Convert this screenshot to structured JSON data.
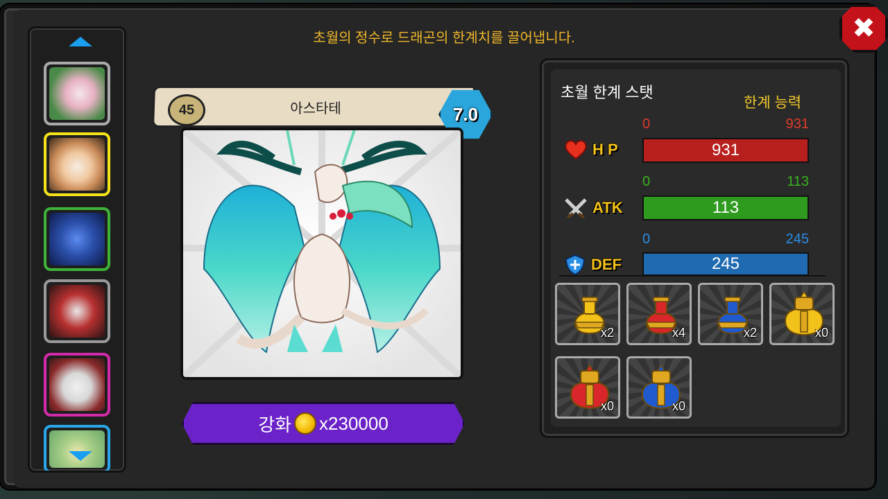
{
  "headline": "초월의 정수로 드래곤의 한계치를 끌어냅니다.",
  "close_label": "✖",
  "dragon": {
    "level": "45",
    "name": "아스타테",
    "grade": "7.0"
  },
  "upgrade": {
    "label": "강화",
    "cost": "x230000"
  },
  "stats_panel": {
    "title": "초월 한계 스탯",
    "limit_title": "한계 능력",
    "stats": [
      {
        "label": "H P",
        "min": "0",
        "max": "931",
        "value": "931",
        "fill": 1.0,
        "color": "#b8201e",
        "label_color": "#e03a2a"
      },
      {
        "label": "ATK",
        "min": "0",
        "max": "113",
        "value": "113",
        "fill": 1.0,
        "color": "#2e9a1e",
        "label_color": "#39b41e"
      },
      {
        "label": "DEF",
        "min": "0",
        "max": "245",
        "value": "245",
        "fill": 1.0,
        "color": "#1f6ab0",
        "label_color": "#2a8ee6"
      }
    ]
  },
  "items": [
    {
      "count": "x2",
      "color": "#f2c21a"
    },
    {
      "count": "x4",
      "color": "#d8262a"
    },
    {
      "count": "x2",
      "color": "#1f5acf"
    },
    {
      "count": "x0",
      "color": "#f2c21a"
    },
    {
      "count": "x0",
      "color": "#d8262a"
    },
    {
      "count": "x0",
      "color": "#1f5acf"
    }
  ],
  "sidebar_dragons": [
    {
      "border": "#3eb33a",
      "bg": "#4a8a48"
    },
    {
      "border": "#f4e21a",
      "bg": "#c98a58"
    },
    {
      "border": "#3eb33a",
      "bg": "#2a4ea8"
    },
    {
      "border": "#9a9a9a",
      "bg": "#4a2a2a"
    },
    {
      "border": "#d22aa8",
      "bg": "#8a2a2a"
    },
    {
      "border": "#2aa6e8",
      "bg": "#6aa86a"
    }
  ]
}
